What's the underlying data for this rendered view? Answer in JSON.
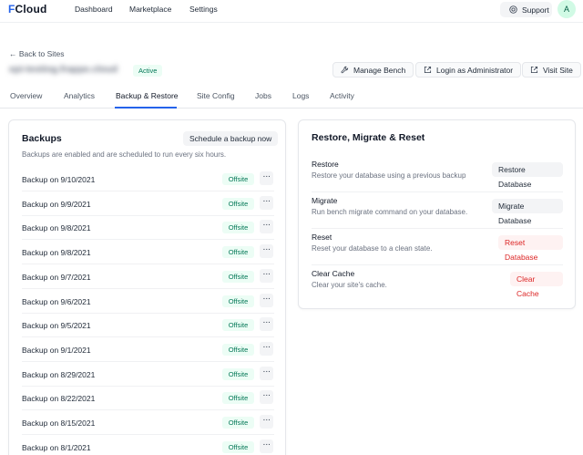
{
  "header": {
    "logo_mark": "F",
    "logo_text": "Cloud",
    "nav": [
      "Dashboard",
      "Marketplace",
      "Settings"
    ],
    "support_label": "Support",
    "avatar_initial": "A"
  },
  "site": {
    "back_label": "← Back to Sites",
    "name": "epi-testing.frappe.cloud",
    "status": "Active",
    "actions": {
      "manage_bench": "Manage Bench",
      "login_admin": "Login as Administrator",
      "visit_site": "Visit Site"
    }
  },
  "tabs": [
    "Overview",
    "Analytics",
    "Backup & Restore",
    "Site Config",
    "Jobs",
    "Logs",
    "Activity"
  ],
  "active_tab": "Backup & Restore",
  "backups": {
    "title": "Backups",
    "schedule_label": "Schedule a backup now",
    "description": "Backups are enabled and are scheduled to run every six hours.",
    "items": [
      {
        "label": "Backup on 9/10/2021",
        "badge": "Offsite"
      },
      {
        "label": "Backup on 9/9/2021",
        "badge": "Offsite"
      },
      {
        "label": "Backup on 9/8/2021",
        "badge": "Offsite"
      },
      {
        "label": "Backup on 9/8/2021",
        "badge": "Offsite"
      },
      {
        "label": "Backup on 9/7/2021",
        "badge": "Offsite"
      },
      {
        "label": "Backup on 9/6/2021",
        "badge": "Offsite"
      },
      {
        "label": "Backup on 9/5/2021",
        "badge": "Offsite"
      },
      {
        "label": "Backup on 9/1/2021",
        "badge": "Offsite"
      },
      {
        "label": "Backup on 8/29/2021",
        "badge": "Offsite"
      },
      {
        "label": "Backup on 8/22/2021",
        "badge": "Offsite"
      },
      {
        "label": "Backup on 8/15/2021",
        "badge": "Offsite"
      },
      {
        "label": "Backup on 8/1/2021",
        "badge": "Offsite"
      }
    ],
    "more_glyph": "···"
  },
  "restore": {
    "title": "Restore, Migrate & Reset",
    "items": [
      {
        "title": "Restore",
        "description": "Restore your database using a previous backup",
        "button": "Restore Database"
      },
      {
        "title": "Migrate",
        "description": "Run bench migrate command on your database.",
        "button": "Migrate Database"
      },
      {
        "title": "Reset",
        "description": "Reset your database to a clean state.",
        "button": "Reset Database"
      },
      {
        "title": "Clear Cache",
        "description": "Clear your site's cache.",
        "button": "Clear Cache"
      }
    ]
  },
  "colors": {
    "accent": "#2563eb",
    "success_bg": "#ecfdf5",
    "success_text": "#047857",
    "danger_text": "#dc2626"
  }
}
